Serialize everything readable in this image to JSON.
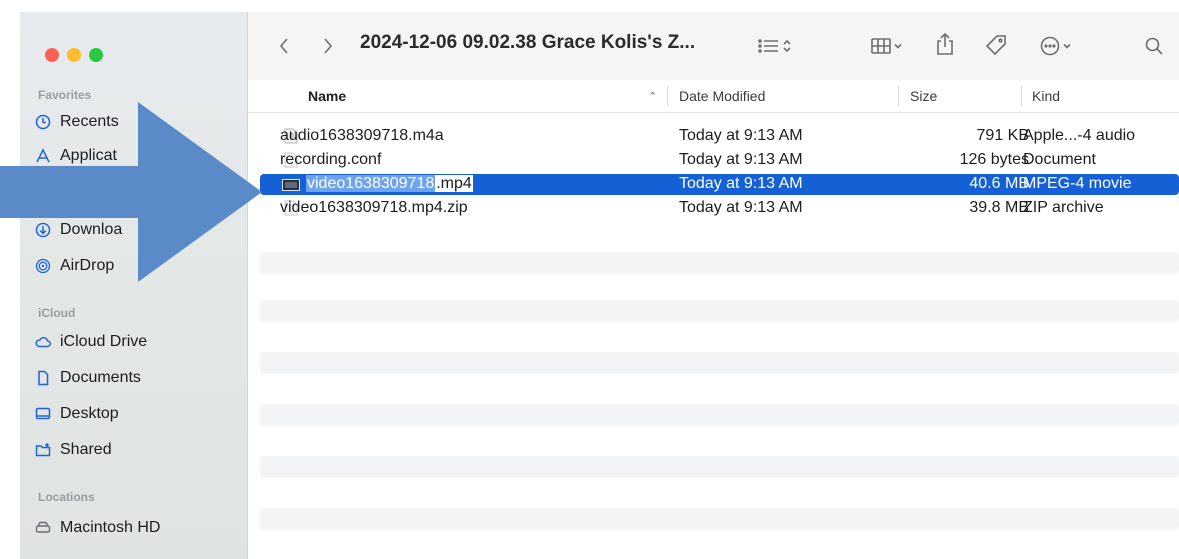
{
  "window": {
    "title": "2024-12-06 09.02.38 Grace Kolis's Z..."
  },
  "colors": {
    "selection": "#1560d5",
    "annotation_arrow": "#5b8ac9",
    "traffic_red": "#fe5f57",
    "traffic_yellow": "#febc2e",
    "traffic_green": "#28c840"
  },
  "sidebar": {
    "sections": {
      "favorites": "Favorites",
      "icloud": "iCloud",
      "locations": "Locations"
    },
    "items": [
      {
        "label": "Recents",
        "icon": "clock-icon"
      },
      {
        "label": "Applicat",
        "icon": "applications-icon"
      },
      {
        "label": "Downloa",
        "icon": "download-icon"
      },
      {
        "label": "AirDrop",
        "icon": "airdrop-icon"
      },
      {
        "label": "iCloud Drive",
        "icon": "cloud-icon"
      },
      {
        "label": "Documents",
        "icon": "document-icon"
      },
      {
        "label": "Desktop",
        "icon": "desktop-icon"
      },
      {
        "label": "Shared",
        "icon": "shared-folder-icon"
      },
      {
        "label": "Macintosh HD",
        "icon": "disk-icon"
      }
    ]
  },
  "columns": {
    "name": "Name",
    "date": "Date Modified",
    "size": "Size",
    "kind": "Kind"
  },
  "files": [
    {
      "name": "audio1638309718.m4a",
      "date": "Today at 9:13 AM",
      "size": "791 KB",
      "kind": "Apple...-4 audio",
      "icon": "audio-file-icon"
    },
    {
      "name": "recording.conf",
      "date": "Today at 9:13 AM",
      "size": "126 bytes",
      "kind": "Document",
      "icon": "document-file-icon"
    },
    {
      "name_selected_part": "video1638309718",
      "name_rest": ".mp4",
      "date": "Today at 9:13 AM",
      "size": "40.6 MB",
      "kind": "MPEG-4 movie",
      "icon": "video-file-icon",
      "selected": true
    },
    {
      "name": "video1638309718.mp4.zip",
      "date": "Today at 9:13 AM",
      "size": "39.8 MB",
      "kind": "ZIP archive",
      "icon": "zip-file-icon"
    }
  ]
}
